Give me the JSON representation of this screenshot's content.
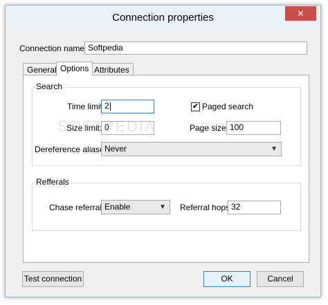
{
  "window": {
    "title": "Connection properties",
    "close_glyph": "✕"
  },
  "connection": {
    "name_label": "Connection name:",
    "name_value": "Softpedia"
  },
  "tabs": [
    {
      "label": "General",
      "active": false
    },
    {
      "label": "Options",
      "active": true
    },
    {
      "label": "Attributes",
      "active": false
    }
  ],
  "search": {
    "group_title": "Search",
    "time_limit_label": "Time limit:",
    "time_limit_value": "2",
    "size_limit_label": "Size limit:",
    "size_limit_value": "0",
    "paged_search_label": "Paged search",
    "paged_search_checked": true,
    "check_glyph": "✔",
    "page_size_label": "Page size:",
    "page_size_value": "100",
    "deref_label": "Dereference aliases:",
    "deref_value": "Never"
  },
  "referrals": {
    "group_title": "Refferals",
    "chase_label": "Chase referrals:",
    "chase_value": "Enable",
    "hops_label": "Referral hops:",
    "hops_value": "32"
  },
  "buttons": {
    "test": "Test connection",
    "ok": "OK",
    "cancel": "Cancel"
  },
  "icons": {
    "dropdown": "chevron-down-icon",
    "close": "close-icon",
    "check": "checkmark-icon"
  },
  "watermark": "SOFTPEDIA",
  "colors": {
    "titlebar": "#e9f1f9",
    "close": "#c7504d",
    "focus_border": "#3c7fb1"
  }
}
